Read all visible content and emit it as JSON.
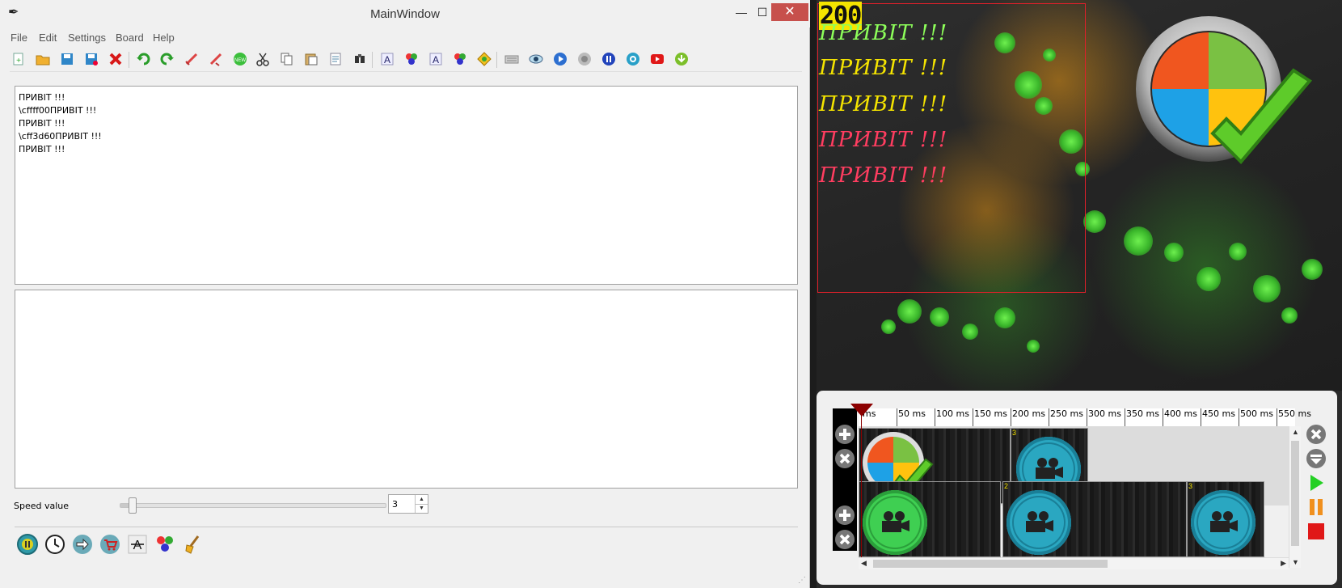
{
  "window": {
    "title": "MainWindow",
    "minimize": "—",
    "maximize": "☐",
    "close": "✕"
  },
  "menu": [
    "File",
    "Edit",
    "Settings",
    "Board",
    "Help"
  ],
  "editor": {
    "lines": [
      "ПРИВІТ !!!",
      "\\cffff00ПРИВІТ !!!",
      "ПРИВІТ !!!",
      "\\cff3d60ПРИВІТ !!!",
      "ПРИВІТ !!!"
    ]
  },
  "speed": {
    "label": "Speed value",
    "value": "3",
    "slider_fraction": 0.03
  },
  "preview": {
    "counter": "200",
    "greetings": [
      {
        "text": "ПРИВІТ !!!",
        "color": "#8dff5a"
      },
      {
        "text": "ПРИВІТ !!!",
        "color": "#f5e400"
      },
      {
        "text": "ПРИВІТ !!!",
        "color": "#f5e400"
      },
      {
        "text": "ПРИВІТ !!!",
        "color": "#ff3d60"
      },
      {
        "text": "ПРИВІТ !!!",
        "color": "#ff3d60"
      }
    ]
  },
  "timeline": {
    "ruler": [
      "ms",
      "50 ms",
      "100 ms",
      "150 ms",
      "200 ms",
      "250 ms",
      "300 ms",
      "350 ms",
      "400 ms",
      "450 ms",
      "500 ms",
      "550 ms"
    ],
    "clip_numbers": [
      "3",
      "2",
      "3"
    ]
  },
  "colors": {
    "accent_red": "#c7504c",
    "selection_rect": "#e0202a",
    "counter_bg": "#f5e400"
  }
}
